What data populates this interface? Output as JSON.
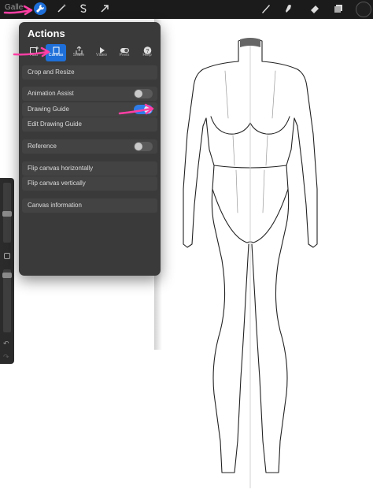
{
  "topbar": {
    "gallery_label": "Galle",
    "tools_left": [
      "wrench-icon",
      "magic-wand-icon",
      "selection-s-icon",
      "transform-arrow-icon"
    ],
    "tools_right": [
      "brush-icon",
      "smudge-icon",
      "eraser-icon",
      "layers-icon"
    ]
  },
  "panel": {
    "title": "Actions",
    "tabs": [
      {
        "label": "Add",
        "icon": "add-image-icon"
      },
      {
        "label": "Canvas",
        "icon": "canvas-icon",
        "active": true
      },
      {
        "label": "Share",
        "icon": "share-icon"
      },
      {
        "label": "Video",
        "icon": "play-icon"
      },
      {
        "label": "Prefs",
        "icon": "toggle-prefs-icon"
      },
      {
        "label": "Help",
        "icon": "help-icon"
      }
    ],
    "rows": {
      "crop": "Crop and Resize",
      "animation": "Animation Assist",
      "drawing_guide": "Drawing Guide",
      "edit_guide": "Edit Drawing Guide",
      "reference": "Reference",
      "flip_h": "Flip canvas horizontally",
      "flip_v": "Flip canvas vertically",
      "info": "Canvas information"
    },
    "toggles": {
      "animation_assist": false,
      "drawing_guide": true,
      "reference": false
    }
  },
  "colors": {
    "accent": "#1e6fd9",
    "annotation_arrow": "#ff3fa4",
    "panel_bg": "#3a3a3a"
  }
}
